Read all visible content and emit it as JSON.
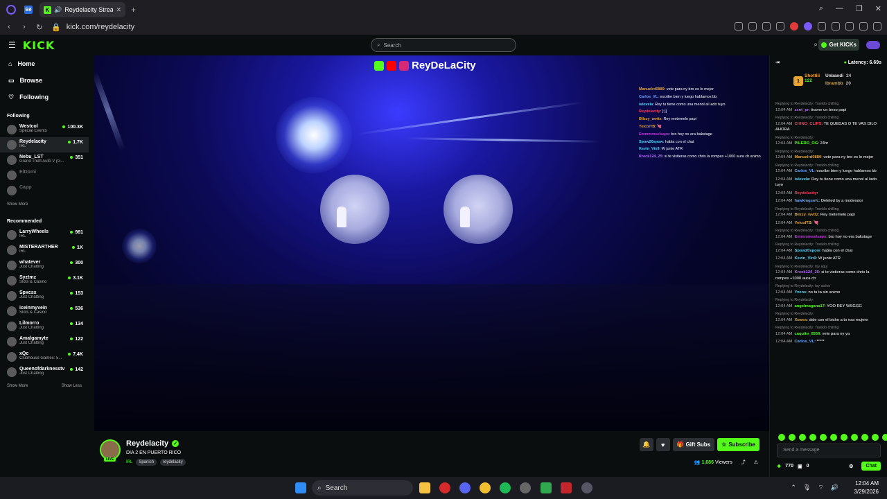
{
  "browser": {
    "tab_badge": "Bē",
    "tab_title": "Reydelacity Stream - V",
    "url": "kick.com/reydelacity"
  },
  "header": {
    "logo": "KICK",
    "search_placeholder": "Search",
    "get_kicks": "Get KICKs"
  },
  "sidebar": {
    "nav": [
      {
        "label": "Home",
        "icon": "home-icon"
      },
      {
        "label": "Browse",
        "icon": "browse-icon"
      },
      {
        "label": "Following",
        "icon": "heart-icon"
      }
    ],
    "following_title": "Following",
    "following": [
      {
        "name": "Westcol",
        "game": "Special Events",
        "viewers": "100.3K",
        "live": true
      },
      {
        "name": "Reydelacity",
        "game": "IRL",
        "viewers": "1.7K",
        "live": true,
        "selected": true
      },
      {
        "name": "Nebu_LST",
        "game": "Grand Theft Auto V (G...",
        "viewers": "351",
        "live": true
      },
      {
        "name": "ElDomi",
        "game": "",
        "viewers": "",
        "live": false
      },
      {
        "name": "Capp",
        "game": "",
        "viewers": "",
        "live": false
      }
    ],
    "show_more": "Show More",
    "recommended_title": "Recommended",
    "recommended": [
      {
        "name": "LarryWheels",
        "game": "IRL",
        "viewers": "981"
      },
      {
        "name": "MISTERARTHER",
        "game": "IRL",
        "viewers": "1K"
      },
      {
        "name": "whatever",
        "game": "Just Chatting",
        "viewers": "300"
      },
      {
        "name": "Syztmz",
        "game": "Slots & Casino",
        "viewers": "3.1K"
      },
      {
        "name": "Spxcsx",
        "game": "Just Chatting",
        "viewers": "153"
      },
      {
        "name": "iceinmyvein",
        "game": "Slots & Casino",
        "viewers": "536"
      },
      {
        "name": "Lilmorro",
        "game": "Just Chatting",
        "viewers": "134"
      },
      {
        "name": "Amalgamyte",
        "game": "Just Chatting",
        "viewers": "122"
      },
      {
        "name": "xQc",
        "game": "Clubhouse Games: 5...",
        "viewers": "7.4K"
      },
      {
        "name": "Queenofdarknesstv",
        "game": "Just Chatting",
        "viewers": "142"
      }
    ],
    "show_more_2": "Show More",
    "show_less": "Show Less"
  },
  "video": {
    "overlay_name": "ReyDeLaCity",
    "overlay_chat": [
      {
        "user": "Manuelrd0880",
        "text": ": vete para ny bro es lo mejor",
        "color": "#e8a531"
      },
      {
        "user": "Carlos_VL",
        "text": ": escribe bien y luego hablamos bb",
        "color": "#6aa7ff"
      },
      {
        "user": "islovela",
        "text": ": Rey tu tiene como una menol al lado tuyo",
        "color": "#53d6fc"
      },
      {
        "user": "Reydelacity",
        "text": ": [:)]",
        "color": "#ff3b5c"
      },
      {
        "user": "Blizzy_wvttz",
        "text": ": Rey metemelo papi",
        "color": "#e8a531"
      },
      {
        "user": "YeicolTB",
        "text": ": 💘",
        "color": "#e8a531"
      },
      {
        "user": "Emmmmselsaps",
        "text": ": bro hoy no era bakstage",
        "color": "#c03ad8"
      },
      {
        "user": "Spow20spow",
        "text": ": habla con el chat",
        "color": "#53d6fc"
      },
      {
        "user": "Kevin_Vin9",
        "text": ": W junte ATR",
        "color": "#53d6fc"
      },
      {
        "user": "Kreck124_25",
        "text": ": si te vistieras como chris la rompes +1000 aura cb animo",
        "color": "#b86bff"
      }
    ]
  },
  "stream_info": {
    "name": "Reydelacity",
    "live_label": "LIVE",
    "title": "DIA 2 EN PUERTO RICO",
    "category": "IRL",
    "tags": [
      "Spanish",
      "reydelacity"
    ],
    "gift_subs": "Gift Subs",
    "subscribe": "Subscribe",
    "viewers_count": "1,686",
    "viewers_label": "Viewers"
  },
  "chat": {
    "latency": "Latency: 6.69s",
    "leaders": [
      {
        "name": "Shottiii",
        "count": "122",
        "color": "#e8a531"
      },
      {
        "name": "Unbandi",
        "count": "24",
        "color": "#ffffff"
      },
      {
        "name": "Ibrambb",
        "count": "20",
        "color": "#e8a531"
      }
    ],
    "messages": [
      {
        "reply": "Replying to Reydelacity: Tranklo chilling",
        "time": "12:04 AM",
        "user": "zxnt_pr",
        "color": "#b86bff",
        "text": ": tirame un beso papi"
      },
      {
        "reply": "Replying to Reydelacity: Tranklo chilling",
        "time": "12:04 AM",
        "user": "CHINO_CLIPS",
        "color": "#ff3b5c",
        "text": ": TE QUEDAS O TE VAS DILO AHORA"
      },
      {
        "reply": "Replying to Reydelacity:",
        "time": "12:04 AM",
        "user": "PILERO_OG",
        "color": "#53fc18",
        "text": ": 24hr"
      },
      {
        "reply": "Replying to Reydelacity:",
        "time": "12:04 AM",
        "user": "Manuelrd0880",
        "color": "#e8a531",
        "text": ": vete para ny bro es lo mejor"
      },
      {
        "reply": "Replying to Reydelacity: Tranklo chilling",
        "time": "12:04 AM",
        "user": "Carlos_VL",
        "color": "#6aa7ff",
        "text": ": escribe bien y luego hablamos bb"
      },
      {
        "reply": "",
        "time": "12:04 AM",
        "user": "islovela",
        "color": "#53d6fc",
        "text": ": Rey tu tiene como una menol al lado tuyo"
      },
      {
        "reply": "",
        "time": "12:04 AM",
        "user": "Reydelacity",
        "color": "#ff3b5c",
        "text": ":"
      },
      {
        "reply": "",
        "time": "12:04 AM",
        "user": "hawkingsofc",
        "color": "#6aa7ff",
        "text": ": Deleted by a moderator"
      },
      {
        "reply": "Replying to Reydelacity: Tranklo chilling",
        "time": "12:04 AM",
        "user": "Blizzy_wvttz",
        "color": "#e8a531",
        "text": ": Rey metemelo papi"
      },
      {
        "reply": "",
        "time": "12:04 AM",
        "user": "YeicolTB",
        "color": "#e8a531",
        "text": ": 💘"
      },
      {
        "reply": "Replying to Reydelacity: Tranklo chilling",
        "time": "12:04 AM",
        "user": "Emmmmselsaps",
        "color": "#c03ad8",
        "text": ": bro hoy no era bakstage"
      },
      {
        "reply": "Replying to Reydelacity: Tranklo chilling",
        "time": "12:04 AM",
        "user": "Spow20spow",
        "color": "#53d6fc",
        "text": ": habla con el chat"
      },
      {
        "reply": "",
        "time": "12:04 AM",
        "user": "Kevin_Vin9",
        "color": "#53d6fc",
        "text": ": W junte ATR"
      },
      {
        "reply": "Replying to Reydelacity: toy aqui",
        "time": "12:04 AM",
        "user": "Kreck124_25",
        "color": "#b86bff",
        "text": ": si te vistieras como chris la rompes +1000 aura cb"
      },
      {
        "reply": "Replying to Reydelacity: toy activo",
        "time": "12:04 AM",
        "user": "Yvens",
        "color": "#53d6fc",
        "text": ": no tu ta sin animo"
      },
      {
        "reply": "Replying to Reydelacity:",
        "time": "12:04 AM",
        "user": "angelmagana17",
        "color": "#53fc18",
        "text": ": YOO REY WSGGG"
      },
      {
        "reply": "Replying to Reydelacity:",
        "time": "12:04 AM",
        "user": "Xtrees",
        "color": "#e8a531",
        "text": ": dale con el bicho a to esa mujere"
      },
      {
        "reply": "Replying to Reydelacity: Tranklo chilling",
        "time": "12:04 AM",
        "user": "caquito_0550",
        "color": "#53fc18",
        "text": ": vete para ny ya"
      },
      {
        "reply": "",
        "time": "12:04 AM",
        "user": "Carlos_VL",
        "color": "#6aa7ff",
        "text": ": *****"
      }
    ],
    "input_placeholder": "Send a message",
    "kicks_count": "770",
    "points": "0",
    "chat_button": "Chat"
  },
  "taskbar": {
    "search": "Search",
    "time": "12:04 AM",
    "date": "3/29/2026"
  }
}
